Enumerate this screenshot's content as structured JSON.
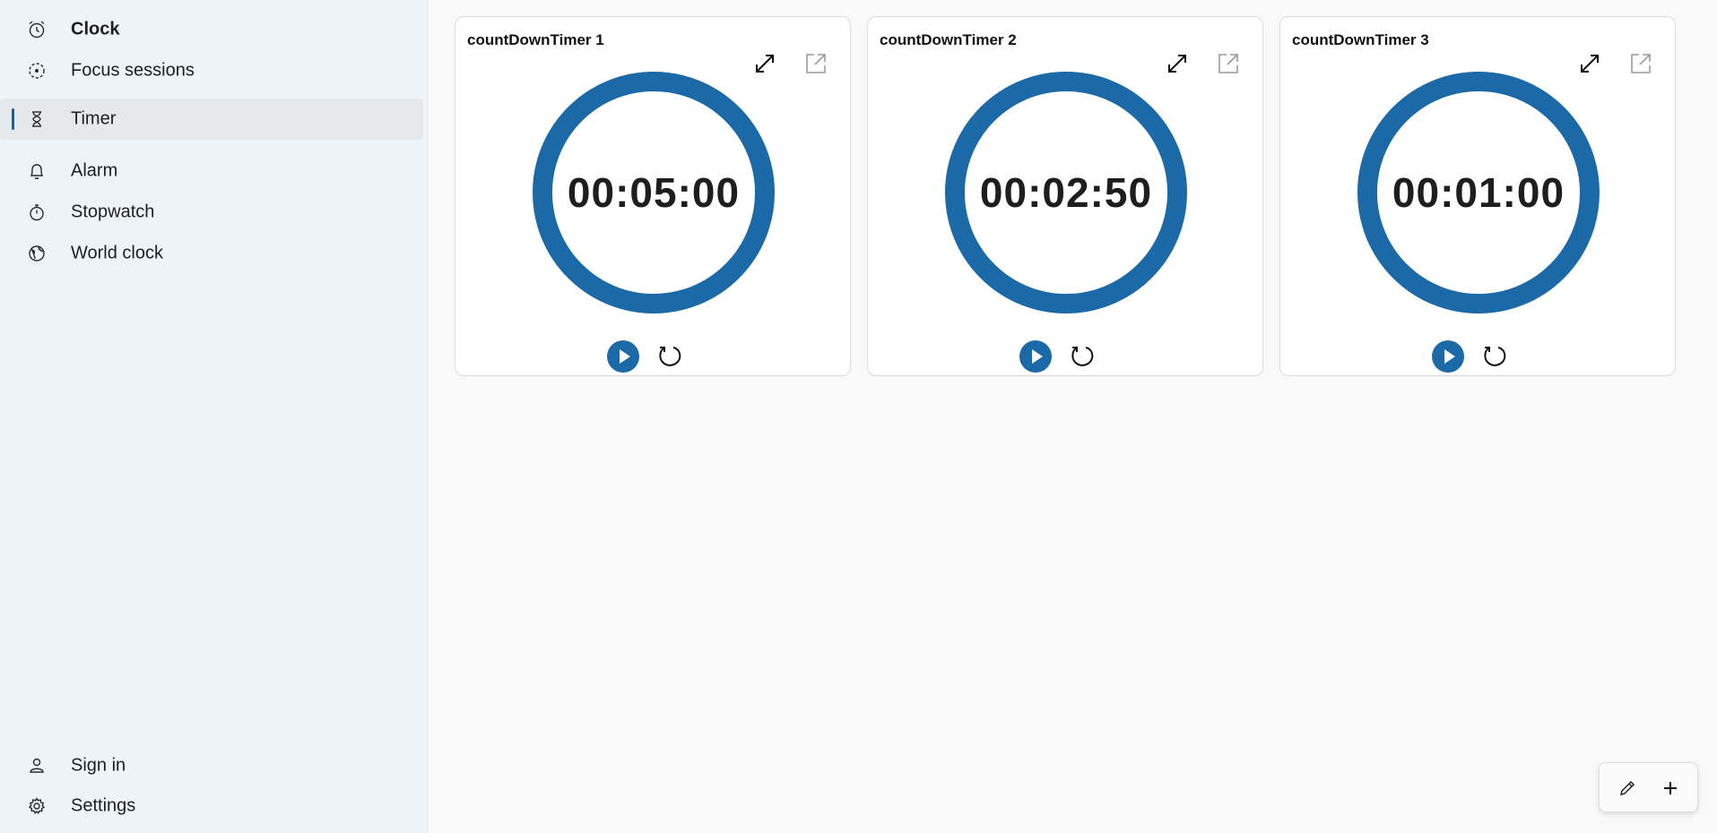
{
  "sidebar": {
    "items": [
      {
        "label": "Clock",
        "icon": "alarm-clock-icon"
      },
      {
        "label": "Focus sessions",
        "icon": "focus-icon"
      },
      {
        "label": "Timer",
        "icon": "hourglass-icon",
        "active": true
      },
      {
        "label": "Alarm",
        "icon": "bell-icon"
      },
      {
        "label": "Stopwatch",
        "icon": "stopwatch-icon"
      },
      {
        "label": "World clock",
        "icon": "globe-icon"
      }
    ],
    "footer": [
      {
        "label": "Sign in",
        "icon": "person-icon"
      },
      {
        "label": "Settings",
        "icon": "gear-icon"
      }
    ]
  },
  "timers": [
    {
      "name": "countDownTimer 1",
      "time": "00:05:00"
    },
    {
      "name": "countDownTimer 2",
      "time": "00:02:50"
    },
    {
      "name": "countDownTimer 3",
      "time": "00:01:00"
    }
  ],
  "colors": {
    "accent": "#1c69a8",
    "sidebar_bg": "#ecf4fa",
    "page_bg": "#f9f9f9"
  }
}
